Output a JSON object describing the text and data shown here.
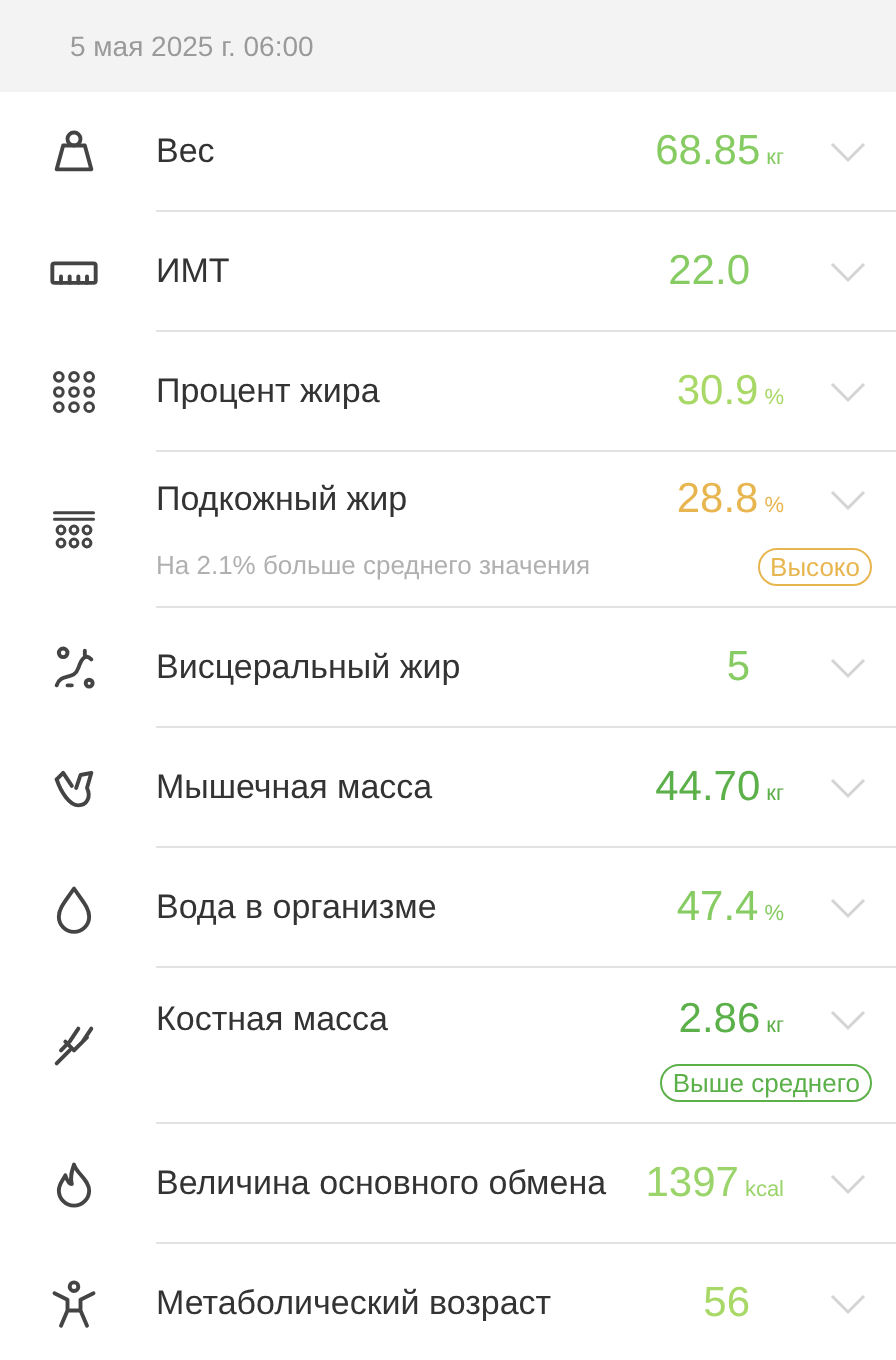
{
  "header": {
    "date": "5 мая 2025 г. 06:00"
  },
  "metrics": [
    {
      "label": "Вес",
      "value": "68.85",
      "unit": "кг",
      "color": "#86cc62"
    },
    {
      "label": "ИМТ",
      "value": "22.0",
      "color": "#86cc62"
    },
    {
      "label": "Процент жира",
      "value": "30.9",
      "unit": "%",
      "color": "#a8d865"
    },
    {
      "label": "Подкожный жир",
      "value": "28.8",
      "unit": "%",
      "color": "#e8b650",
      "note": "На 2.1% больше среднего значения",
      "badge": {
        "text": "Высоко",
        "color": "#e8b650"
      }
    },
    {
      "label": "Висцеральный жир",
      "value": "5",
      "color": "#86cc62"
    },
    {
      "label": "Мышечная масса",
      "value": "44.70",
      "unit": "кг",
      "color": "#5cb04a"
    },
    {
      "label": "Вода в организме",
      "value": "47.4",
      "unit": "%",
      "color": "#86cc62"
    },
    {
      "label": "Костная масса",
      "value": "2.86",
      "unit": "кг",
      "color": "#5cb04a",
      "badge": {
        "text": "Выше среднего",
        "color": "#5cb04a"
      }
    },
    {
      "label": "Величина основного обмена",
      "value": "1397",
      "unit": "kcal",
      "color": "#9ad46a"
    },
    {
      "label": "Метаболический возраст",
      "value": "56",
      "color": "#a8d865"
    }
  ]
}
